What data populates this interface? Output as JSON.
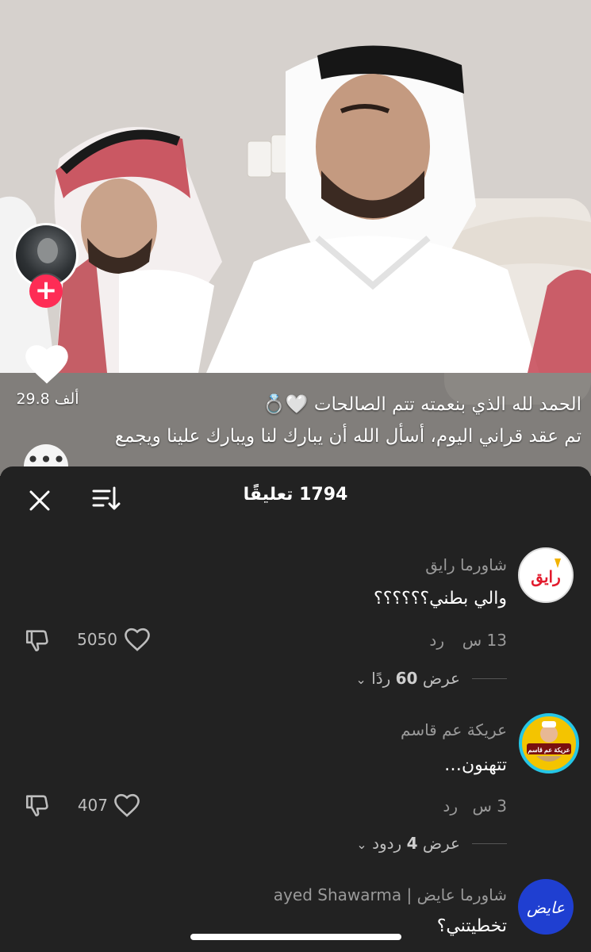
{
  "video": {
    "caption_line1": "الحمد لله الذي بنعمته تتم الصالحات 🤍💍",
    "caption_line2": "تم عقد قراني اليوم، أسأل الله أن يبارك لنا ويبارك علينا ويجمع",
    "like_count": "29.8 ألف",
    "icons": {
      "heart": "heart-icon",
      "follow": "plus-icon",
      "more": "ellipsis-icon"
    }
  },
  "sheet": {
    "title": "1794 تعليقًا",
    "icons": {
      "close": "close-icon",
      "sort": "sort-icon"
    }
  },
  "comments": [
    {
      "author": "شاورما رايق",
      "avatar_text": "رايق",
      "avatar_bg": "#ffffff",
      "avatar_fg": "#e21b2d",
      "text": "والي بطني؟؟؟؟؟؟",
      "time": "13 س",
      "reply_label": "رد",
      "likes": "5050",
      "view_replies_label": "عرض",
      "view_replies_count": "60",
      "view_replies_unit": "ردًا"
    },
    {
      "author": "عريكة عم قاسم",
      "avatar_text": "عريكة عم قاسم",
      "avatar_bg": "#f4c400",
      "avatar_fg": "#7a1010",
      "text": "تتهنون…",
      "time": "3 س",
      "reply_label": "رد",
      "likes": "407",
      "view_replies_label": "عرض",
      "view_replies_count": "4",
      "view_replies_unit": "ردود"
    },
    {
      "author": "شاورما عايض | ayed Shawarma",
      "avatar_text": "عايض",
      "avatar_bg": "#1f3fd1",
      "avatar_fg": "#ffffff",
      "text": "تخطيتني؟"
    }
  ],
  "colors": {
    "accent": "#fe2c55",
    "sheet_bg": "#222222",
    "muted_text": "#9a9a9a",
    "story_ring": "#25c6e6"
  }
}
